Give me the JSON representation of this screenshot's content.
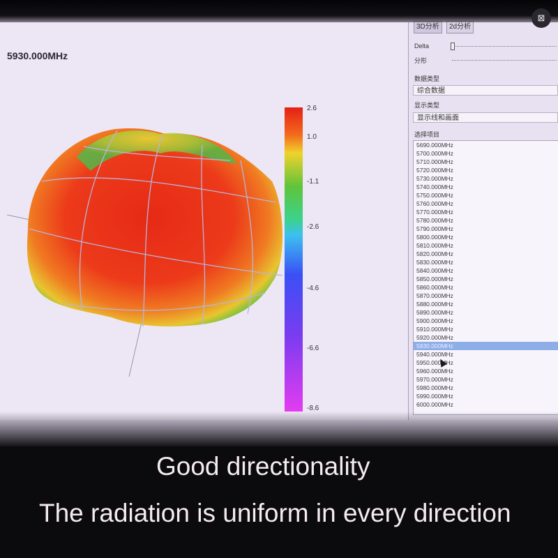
{
  "plot": {
    "frequency_title": "5930.000MHz",
    "colorbar_labels": [
      "2.6",
      "1.0",
      "-1.1",
      "-2.6",
      "-4.6",
      "-6.6",
      "-8.6"
    ]
  },
  "controls": {
    "tab_3d": "3D分析",
    "tab_2d": "2d分析",
    "delta_label": "Delta",
    "fractal_label": "分形",
    "data_type_label": "数据类型",
    "data_type_value": "综合数据",
    "display_type_label": "显示类型",
    "display_type_value": "显示线和画面",
    "select_item_label": "选择项目"
  },
  "frequency_list": [
    "5690.000MHz",
    "5700.000MHz",
    "5710.000MHz",
    "5720.000MHz",
    "5730.000MHz",
    "5740.000MHz",
    "5750.000MHz",
    "5760.000MHz",
    "5770.000MHz",
    "5780.000MHz",
    "5790.000MHz",
    "5800.000MHz",
    "5810.000MHz",
    "5820.000MHz",
    "5830.000MHz",
    "5840.000MHz",
    "5850.000MHz",
    "5860.000MHz",
    "5870.000MHz",
    "5880.000MHz",
    "5890.000MHz",
    "5900.000MHz",
    "5910.000MHz",
    "5920.000MHz",
    "5930.000MHz",
    "5940.000MHz",
    "5950.000MHz",
    "5960.000MHz",
    "5970.000MHz",
    "5980.000MHz",
    "5990.000MHz",
    "6000.000MHz"
  ],
  "selected_frequency": "5930.000MHz",
  "corner_icon": "close-x-icon",
  "captions": {
    "line1": "Good directionality",
    "line2": "The radiation is uniform in every direction"
  },
  "colors": {
    "selection": "#8eaee8",
    "caption_text": "#f4ecef"
  }
}
